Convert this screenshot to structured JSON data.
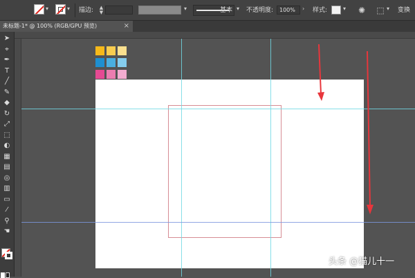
{
  "control_bar": {
    "stroke_label": "描边",
    "stroke_weight_value": "",
    "stroke_profile_label": "基本",
    "opacity_label": "不透明度",
    "opacity_value": "100%",
    "style_label": "样式",
    "transform_label": "变换"
  },
  "document": {
    "tab_title": "未标题-1* @ 100% (RGB/GPU 预览)",
    "close_symbol": "×"
  },
  "toolbar": {
    "tools": [
      {
        "name": "selection-tool",
        "glyph": "➤"
      },
      {
        "name": "direct-selection-tool",
        "glyph": "⌖"
      },
      {
        "name": "pen-tool",
        "glyph": "✒"
      },
      {
        "name": "type-tool",
        "glyph": "T"
      },
      {
        "name": "line-tool",
        "glyph": "╱"
      },
      {
        "name": "paintbrush-tool",
        "glyph": "✎"
      },
      {
        "name": "eraser-tool",
        "glyph": "◆"
      },
      {
        "name": "rotate-tool",
        "glyph": "↻"
      },
      {
        "name": "scale-tool",
        "glyph": "⤢"
      },
      {
        "name": "free-transform-tool",
        "glyph": "⬚"
      },
      {
        "name": "shape-builder-tool",
        "glyph": "◐"
      },
      {
        "name": "perspective-grid-tool",
        "glyph": "▦"
      },
      {
        "name": "gradient-tool",
        "glyph": "▤"
      },
      {
        "name": "blend-tool",
        "glyph": "◎"
      },
      {
        "name": "column-graph-tool",
        "glyph": "▥"
      },
      {
        "name": "artboard-tool",
        "glyph": "▭"
      },
      {
        "name": "eyedropper-tool",
        "glyph": "⁄"
      },
      {
        "name": "zoom-tool",
        "glyph": "⚲"
      },
      {
        "name": "hand-tool",
        "glyph": "☚"
      }
    ]
  },
  "swatches": [
    [
      "#f6b91a",
      "#f9cd4f",
      "#fbe08f"
    ],
    [
      "#1e8fd0",
      "#4aafe0",
      "#85cdee"
    ],
    [
      "#e54a93",
      "#ec7db0",
      "#f3acd0"
    ]
  ],
  "colors": {
    "workspace": "#535353",
    "artboard": "#ffffff",
    "guide_cyan": "#71d8e4",
    "guide_blue": "#7b97de",
    "rectangle_stroke": "#d68b93",
    "arrow": "#e8363c"
  },
  "watermark": "头条 @猫儿十一"
}
